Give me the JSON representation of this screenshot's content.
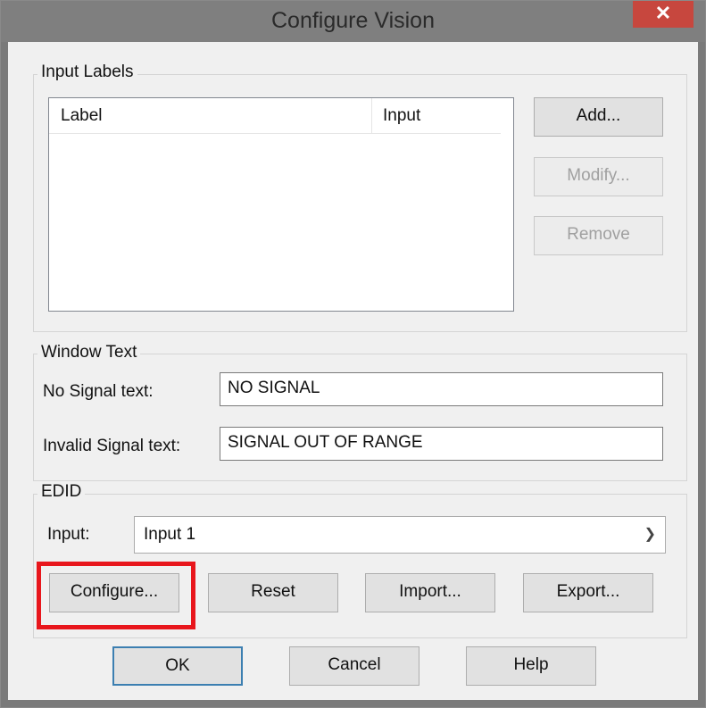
{
  "window": {
    "title": "Configure Vision",
    "close_glyph": "✕"
  },
  "input_labels": {
    "legend": "Input Labels",
    "columns": [
      "Label",
      "Input"
    ],
    "rows": [],
    "buttons": {
      "add": "Add...",
      "modify": "Modify...",
      "remove": "Remove"
    }
  },
  "window_text": {
    "legend": "Window Text",
    "no_signal_label": "No Signal text:",
    "no_signal_value": "NO SIGNAL",
    "invalid_signal_label": "Invalid Signal text:",
    "invalid_signal_value": "SIGNAL OUT OF RANGE"
  },
  "edid": {
    "legend": "EDID",
    "input_label": "Input:",
    "input_selected": "Input 1",
    "buttons": {
      "configure": "Configure...",
      "reset": "Reset",
      "import": "Import...",
      "export": "Export..."
    }
  },
  "footer": {
    "ok": "OK",
    "cancel": "Cancel",
    "help": "Help"
  },
  "colors": {
    "highlight": "#e8161c",
    "close_button": "#c7473e",
    "titlebar": "#7f7f7f"
  }
}
